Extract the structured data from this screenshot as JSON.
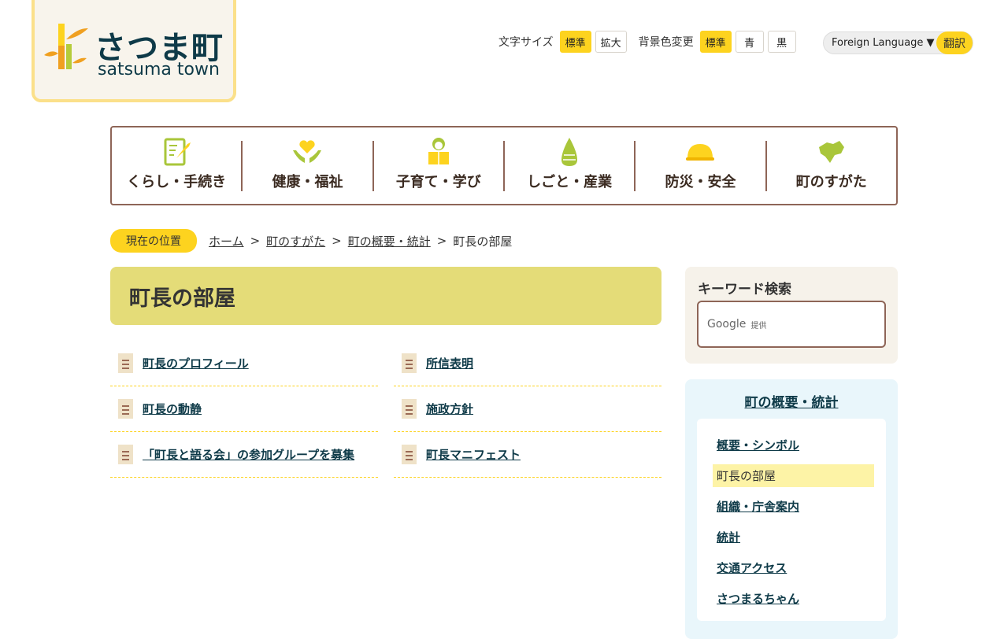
{
  "logo": {
    "jp": "さつま町",
    "en": "satsuma town"
  },
  "tools": {
    "font_size_label": "文字サイズ",
    "font_standard": "標準",
    "font_large": "拡大",
    "bg_label": "背景色変更",
    "bg_standard": "標準",
    "bg_blue": "青",
    "bg_black": "黒",
    "language": "Foreign Language ▼",
    "translate": "翻訳"
  },
  "gnav": [
    {
      "label": "くらし・手続き"
    },
    {
      "label": "健康・福祉"
    },
    {
      "label": "子育て・学び"
    },
    {
      "label": "しごと・産業"
    },
    {
      "label": "防災・安全"
    },
    {
      "label": "町のすがた"
    }
  ],
  "breadcrumb": {
    "here": "現在の位置",
    "items": [
      "ホーム",
      "町のすがた",
      "町の概要・統計"
    ],
    "current": "町長の部屋",
    "sep": ">"
  },
  "page_title": "町長の部屋",
  "links": [
    "町長のプロフィール",
    "所信表明",
    "町長の動静",
    "施政方針",
    "「町長と語る会」の参加グループを募集",
    "町長マニフェスト"
  ],
  "search": {
    "title": "キーワード検索",
    "google": "Google",
    "provided": "提供"
  },
  "side": {
    "title": "町の概要・統計",
    "items": [
      "概要・シンボル",
      "町長の部屋",
      "組織・庁舎案内",
      "統計",
      "交通アクセス",
      "さつまるちゃん"
    ]
  }
}
